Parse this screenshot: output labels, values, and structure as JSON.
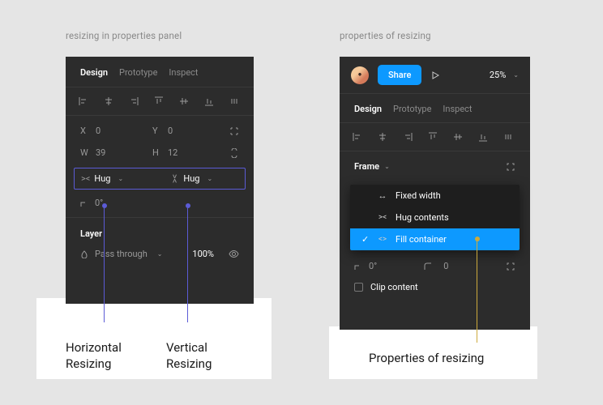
{
  "left": {
    "section_label": "resizing in properties panel",
    "tabs": {
      "design": "Design",
      "prototype": "Prototype",
      "inspect": "Inspect"
    },
    "pos": {
      "x_label": "X",
      "x_value": "0",
      "y_label": "Y",
      "y_value": "0",
      "w_label": "W",
      "w_value": "39",
      "h_label": "H",
      "h_value": "12"
    },
    "hug": {
      "h_text": "Hug",
      "v_text": "Hug"
    },
    "rotation": "0°",
    "layer_title": "Layer",
    "blend_mode": "Pass through",
    "opacity": "100%",
    "annot_h": "Horizontal\nResizing",
    "annot_v": "Vertical\nResizing"
  },
  "right": {
    "section_label": "properties of resizing",
    "share": "Share",
    "zoom": "25%",
    "tabs": {
      "design": "Design",
      "prototype": "Prototype",
      "inspect": "Inspect"
    },
    "frame": "Frame",
    "options": {
      "fixed": "Fixed width",
      "hug": "Hug contents",
      "fill": "Fill container"
    },
    "rotation": "0°",
    "radius": "0",
    "clip": "Clip content",
    "annot": "Properties of resizing"
  }
}
